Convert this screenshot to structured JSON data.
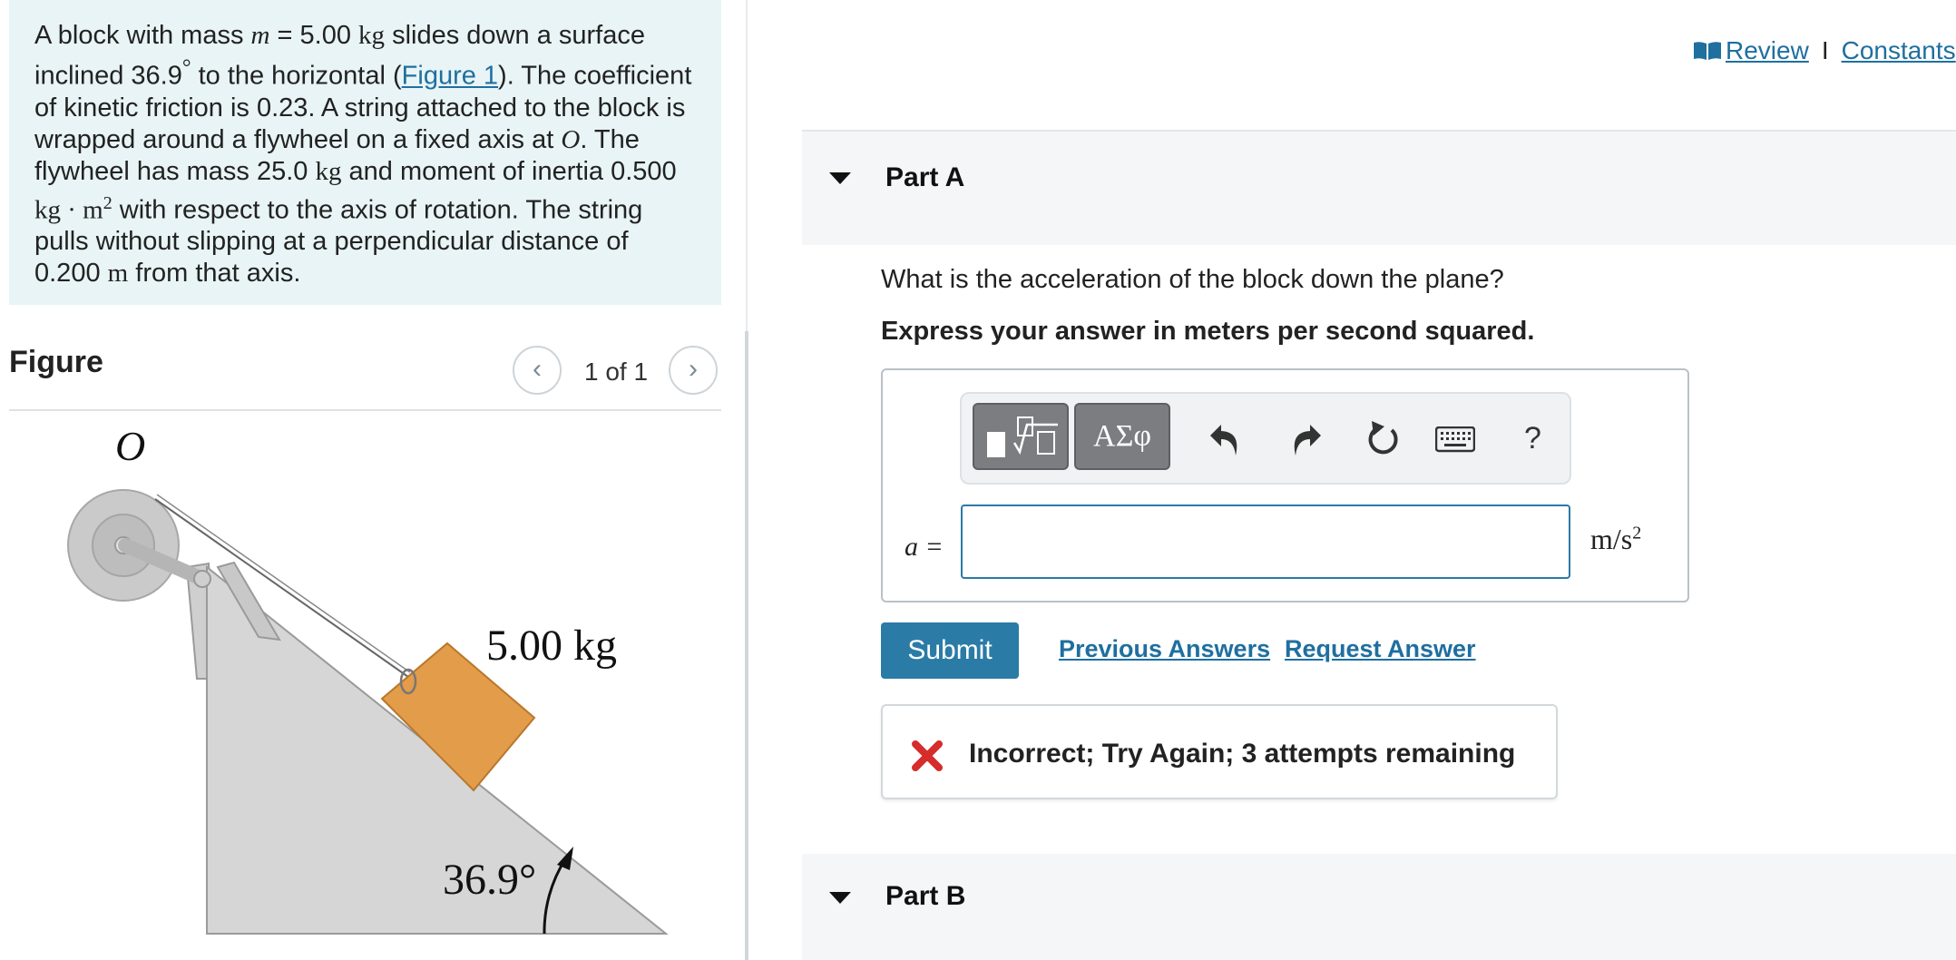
{
  "problem": {
    "intro": "A block with mass ",
    "mass_var": "m",
    "mass_eq": " = 5.00 ",
    "mass_unit": "kg",
    "after_mass": " slides down a surface inclined 36.9",
    "degree": "°",
    "after_angle": " to the horizontal (",
    "figure_link": "Figure 1",
    "after_link": "). The coefficient of kinetic friction is 0.23. A string attached to the block is wrapped around a flywheel on a fixed axis at ",
    "axis_var": "O",
    "after_axis": ". The flywheel has mass 25.0 ",
    "flywheel_unit": "kg",
    "after_flywheel": " and moment of inertia 0.500 ",
    "inertia_unit": "kg · m",
    "inertia_exp": "2",
    "after_inertia": " with respect to the axis of rotation. The string pulls without slipping at a perpendicular distance of 0.200 ",
    "distance_unit": "m",
    "ending": " from that axis."
  },
  "figure": {
    "title": "Figure",
    "counter": "1 of 1",
    "prev_icon": "chevron-left-icon",
    "next_icon": "chevron-right-icon",
    "axis_label": "O",
    "mass_label": "5.00 kg",
    "angle_label": "36.9°",
    "colors": {
      "block": "#e39c4a",
      "incline": "#d6d6d6",
      "flywheel": "#c9c9c9"
    }
  },
  "header": {
    "review_label": "Review",
    "separator": "I",
    "constants_label": "Constants"
  },
  "partA": {
    "label": "Part A",
    "question": "What is the acceleration of the block down the plane?",
    "instruction": "Express your answer in meters per second squared.",
    "symbols_label": "ΑΣφ",
    "help_label": "?",
    "variable_label": "a =",
    "input_value": "",
    "unit": "m/s",
    "unit_exp": "2",
    "submit_label": "Submit",
    "previous_answers_label": "Previous Answers",
    "request_answer_label": "Request Answer",
    "feedback": "Incorrect; Try Again; 3 attempts remaining",
    "feedback_color": "#d62c2c"
  },
  "partB": {
    "label": "Part B"
  }
}
